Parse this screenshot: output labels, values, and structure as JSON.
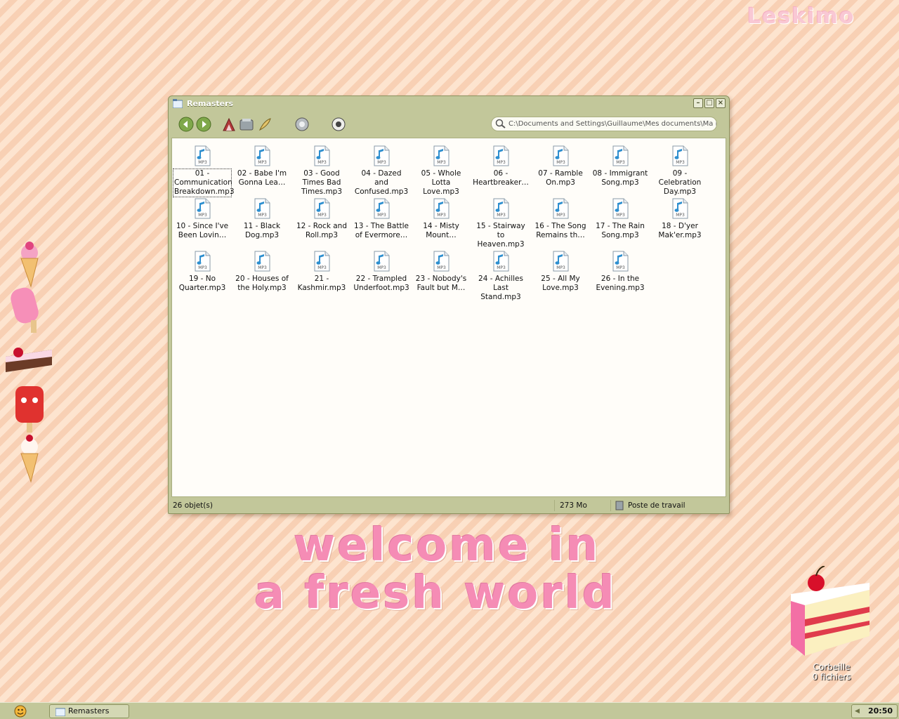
{
  "desktop": {
    "brand": "Leskimo",
    "welcome_line1": "welcome in",
    "welcome_line2": "a fresh world",
    "recycle_bin": {
      "name": "Corbeille",
      "count": "0 fichiers"
    }
  },
  "window": {
    "title": "Remasters",
    "address": "C:\\Documents and Settings\\Guillaume\\Mes documents\\Ma mu",
    "file_badge": "MP3",
    "files": [
      "01 - Communication Breakdown.mp3",
      "02 - Babe I'm Gonna Lea…",
      "03 - Good Times Bad Times.mp3",
      "04 - Dazed and Confused.mp3",
      "05 - Whole Lotta Love.mp3",
      "06 - Heartbreaker…",
      "07 - Ramble On.mp3",
      "08 - Immigrant Song.mp3",
      "09 - Celebration Day.mp3",
      "10 - Since I've Been Lovin…",
      "11 - Black Dog.mp3",
      "12 - Rock and Roll.mp3",
      "13 - The Battle of Evermore…",
      "14 - Misty Mount…",
      "15 - Stairway to Heaven.mp3",
      "16 - The Song Remains th…",
      "17 - The Rain Song.mp3",
      "18 - D'yer Mak'er.mp3",
      "19 - No Quarter.mp3",
      "20 - Houses of the Holy.mp3",
      "21 - Kashmir.mp3",
      "22 - Trampled Underfoot.mp3",
      "23 - Nobody's Fault but M…",
      "24 - Achilles Last Stand.mp3",
      "25 - All My Love.mp3",
      "26 - In the Evening.mp3"
    ],
    "status": {
      "count": "26 objet(s)",
      "size": "273 Mo",
      "location": "Poste de travail"
    }
  },
  "taskbar": {
    "task": "Remasters",
    "clock": "20:50"
  }
}
